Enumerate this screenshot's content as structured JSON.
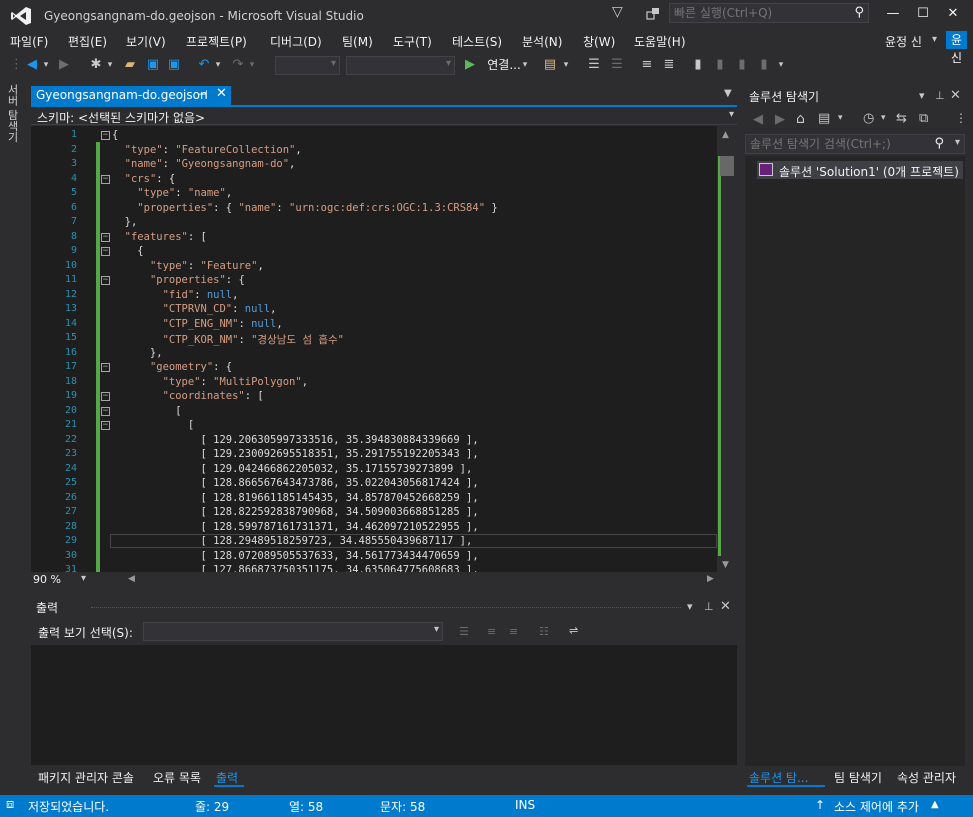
{
  "window": {
    "title": "Gyeongsangnam-do.geojson - Microsoft Visual Studio",
    "quick_launch_placeholder": "빠른 실행(Ctrl+Q)"
  },
  "menu": [
    "파일(F)",
    "편집(E)",
    "보기(V)",
    "프로젝트(P)",
    "디버그(D)",
    "팀(M)",
    "도구(T)",
    "테스트(S)",
    "분석(N)",
    "창(W)",
    "도움말(H)"
  ],
  "user": {
    "name": "윤정 신",
    "initials": "윤신"
  },
  "toolbar": {
    "attach_label": "연결..."
  },
  "left_strip": {
    "label": "서버 탐색기"
  },
  "editor": {
    "tab_title": "Gyeongsangnam-do.geojson",
    "schema_label": "스키마: <선택된 스키마가 없음>",
    "zoom": "90 %",
    "lines": [
      "{",
      "  \"type\": \"FeatureCollection\",",
      "  \"name\": \"Gyeongsangnam-do\",",
      "  \"crs\": {",
      "    \"type\": \"name\",",
      "    \"properties\": { \"name\": \"urn:ogc:def:crs:OGC:1.3:CRS84\" }",
      "  },",
      "  \"features\": [",
      "    {",
      "      \"type\": \"Feature\",",
      "      \"properties\": {",
      "        \"fid\": null,",
      "        \"CTPRVN_CD\": null,",
      "        \"CTP_ENG_NM\": null,",
      "        \"CTP_KOR_NM\": \"경상남도 섬 흡수\"",
      "      },",
      "      \"geometry\": {",
      "        \"type\": \"MultiPolygon\",",
      "        \"coordinates\": [",
      "          [",
      "            [",
      "              [ 129.206305997333516, 35.394830884339669 ],",
      "              [ 129.230092695518351, 35.291755192205343 ],",
      "              [ 129.042466862205032, 35.17155739273899 ],",
      "              [ 128.866567643473786, 35.022043056817424 ],",
      "              [ 128.819661185145435, 34.857870452668259 ],",
      "              [ 128.822592838790968, 34.509003668851285 ],",
      "              [ 128.599787161731371, 34.462097210522955 ],",
      "              [ 128.29489518259723, 34.485550439687117 ],",
      "              [ 128.072089505537633, 34.561773434470659 ],",
      "              [ 127.866873750351175, 34.635064775608683 ],"
    ]
  },
  "output": {
    "title": "출력",
    "select_label": "출력 보기 선택(S):"
  },
  "bottom_tabs": [
    "패키지 관리자 콘솔",
    "오류 목록",
    "출력"
  ],
  "solution_explorer": {
    "title": "솔루션 탐색기",
    "search_placeholder": "솔루션 탐색기 검색(Ctrl+;)",
    "solution_label": "솔루션 'Solution1' (0개 프로젝트)",
    "tabs": [
      "솔루션 탐...",
      "팀 탐색기",
      "속성 관리자"
    ]
  },
  "status": {
    "message": "저장되었습니다.",
    "line": "줄: 29",
    "col": "열: 58",
    "ch": "문자: 58",
    "mode": "INS",
    "source_control": "소스 제어에 추가"
  },
  "colors": {
    "accent": "#007acc",
    "editor_bg": "#1e1e1e",
    "chrome_bg": "#2d2d30"
  }
}
